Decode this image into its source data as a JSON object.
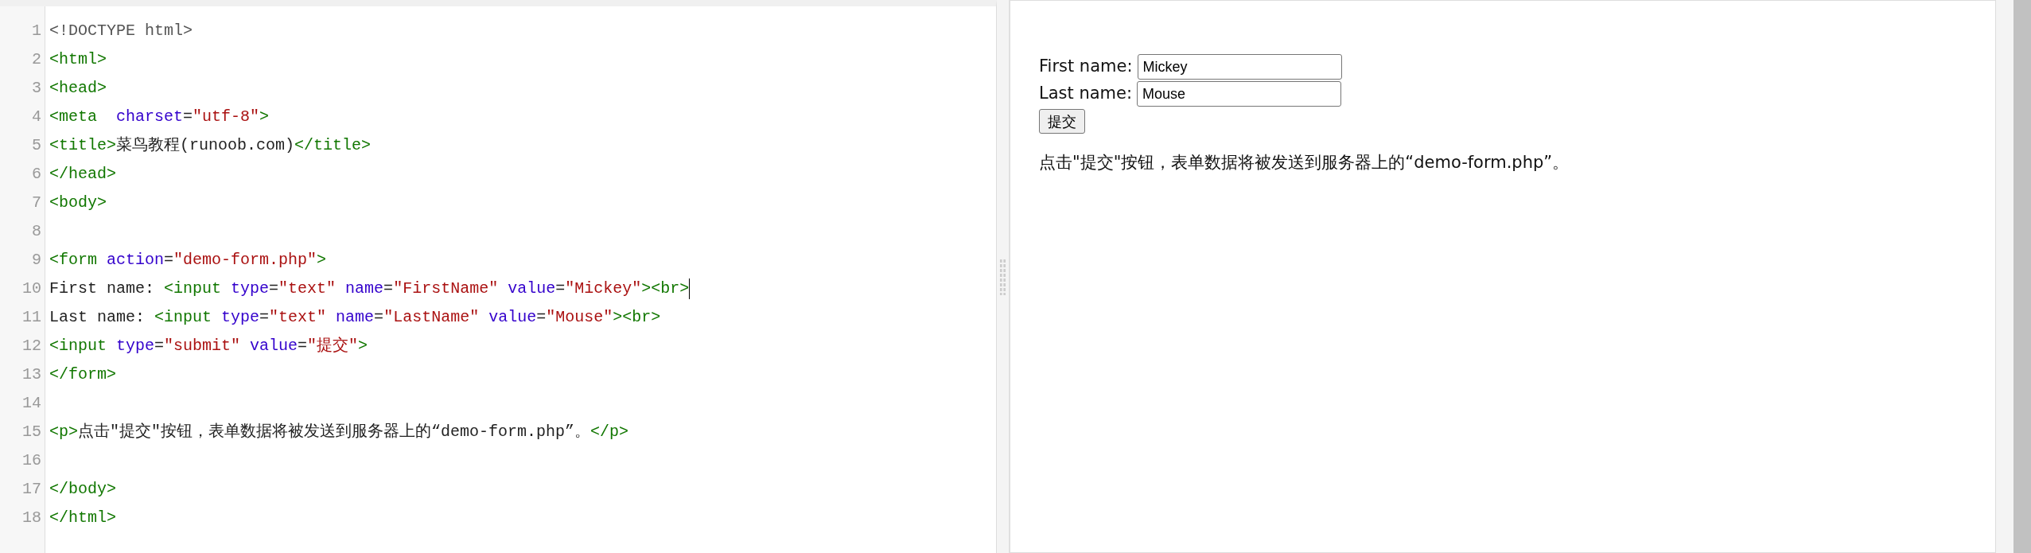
{
  "editor": {
    "lines": [
      {
        "number": "1",
        "tokens": [
          {
            "kind": "doctype",
            "text": "<!DOCTYPE html>"
          }
        ]
      },
      {
        "number": "2",
        "tokens": [
          {
            "kind": "tag",
            "text": "<html>"
          }
        ]
      },
      {
        "number": "3",
        "tokens": [
          {
            "kind": "tag",
            "text": "<head>"
          }
        ]
      },
      {
        "number": "4",
        "tokens": [
          {
            "kind": "tag",
            "text": "<meta  "
          },
          {
            "kind": "attr",
            "text": "charset"
          },
          {
            "kind": "text",
            "text": "="
          },
          {
            "kind": "string",
            "text": "\"utf-8\""
          },
          {
            "kind": "tag",
            "text": ">"
          }
        ]
      },
      {
        "number": "5",
        "tokens": [
          {
            "kind": "tag",
            "text": "<title>"
          },
          {
            "kind": "text",
            "text": "菜鸟教程(runoob.com)"
          },
          {
            "kind": "tag",
            "text": "</title>"
          }
        ]
      },
      {
        "number": "6",
        "tokens": [
          {
            "kind": "tag",
            "text": "</head>"
          }
        ]
      },
      {
        "number": "7",
        "tokens": [
          {
            "kind": "tag",
            "text": "<body>"
          }
        ]
      },
      {
        "number": "8"
      },
      {
        "number": "9",
        "tokens": [
          {
            "kind": "tag",
            "text": "<form "
          },
          {
            "kind": "attr",
            "text": "action"
          },
          {
            "kind": "text",
            "text": "="
          },
          {
            "kind": "string",
            "text": "\"demo-form.php\""
          },
          {
            "kind": "tag",
            "text": ">"
          }
        ]
      },
      {
        "number": "10",
        "cursor": true,
        "tokens": [
          {
            "kind": "text",
            "text": "First name: "
          },
          {
            "kind": "tag",
            "text": "<input "
          },
          {
            "kind": "attr",
            "text": "type"
          },
          {
            "kind": "text",
            "text": "="
          },
          {
            "kind": "string",
            "text": "\"text\""
          },
          {
            "kind": "attr",
            "text": " name"
          },
          {
            "kind": "text",
            "text": "="
          },
          {
            "kind": "string",
            "text": "\"FirstName\""
          },
          {
            "kind": "attr",
            "text": " value"
          },
          {
            "kind": "text",
            "text": "="
          },
          {
            "kind": "string",
            "text": "\"Mickey\""
          },
          {
            "kind": "tag",
            "text": "><br>"
          }
        ]
      },
      {
        "number": "11",
        "tokens": [
          {
            "kind": "text",
            "text": "Last name: "
          },
          {
            "kind": "tag",
            "text": "<input "
          },
          {
            "kind": "attr",
            "text": "type"
          },
          {
            "kind": "text",
            "text": "="
          },
          {
            "kind": "string",
            "text": "\"text\""
          },
          {
            "kind": "attr",
            "text": " name"
          },
          {
            "kind": "text",
            "text": "="
          },
          {
            "kind": "string",
            "text": "\"LastName\""
          },
          {
            "kind": "attr",
            "text": " value"
          },
          {
            "kind": "text",
            "text": "="
          },
          {
            "kind": "string",
            "text": "\"Mouse\""
          },
          {
            "kind": "tag",
            "text": "><br>"
          }
        ]
      },
      {
        "number": "12",
        "tokens": [
          {
            "kind": "tag",
            "text": "<input "
          },
          {
            "kind": "attr",
            "text": "type"
          },
          {
            "kind": "text",
            "text": "="
          },
          {
            "kind": "string",
            "text": "\"submit\""
          },
          {
            "kind": "attr",
            "text": " value"
          },
          {
            "kind": "text",
            "text": "="
          },
          {
            "kind": "string",
            "text": "\"提交\""
          },
          {
            "kind": "tag",
            "text": ">"
          }
        ]
      },
      {
        "number": "13",
        "tokens": [
          {
            "kind": "tag",
            "text": "</form>"
          }
        ]
      },
      {
        "number": "14"
      },
      {
        "number": "15",
        "tokens": [
          {
            "kind": "tag",
            "text": "<p>"
          },
          {
            "kind": "text",
            "text": "点击\"提交\"按钮，表单数据将被发送到服务器上的“demo-form.php”。"
          },
          {
            "kind": "tag",
            "text": "</p>"
          }
        ]
      },
      {
        "number": "16"
      },
      {
        "number": "17",
        "tokens": [
          {
            "kind": "tag",
            "text": "</body>"
          }
        ]
      },
      {
        "number": "18",
        "tokens": [
          {
            "kind": "tag",
            "text": "</html>"
          }
        ]
      }
    ]
  },
  "preview": {
    "fields": [
      {
        "label": "First name:",
        "value": "Mickey"
      },
      {
        "label": "Last name:",
        "value": "Mouse"
      }
    ],
    "submit": "提交",
    "paragraph": "点击\"提交\"按钮，表单数据将被发送到服务器上的“demo-form.php”。"
  }
}
